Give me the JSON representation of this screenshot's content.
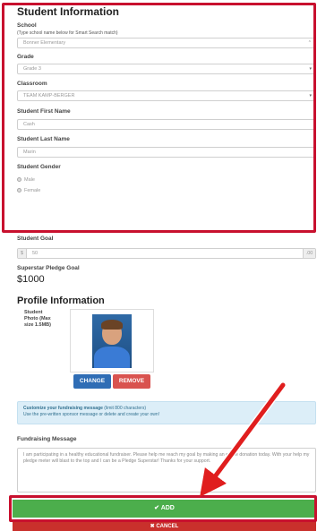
{
  "student_info": {
    "title": "Student Information",
    "school_label": "School",
    "school_hint": "(Type school name below for Smart Search match)",
    "school_value": "Bonner Elementary",
    "grade_label": "Grade",
    "grade_value": "Grade 3",
    "classroom_label": "Classroom",
    "classroom_value": "TEAM KAMP-BERGER",
    "first_name_label": "Student First Name",
    "first_name_value": "Cash",
    "last_name_label": "Student Last Name",
    "last_name_value": "Marin",
    "gender_label": "Student Gender",
    "gender_options": [
      "Male",
      "Female"
    ]
  },
  "goal": {
    "label": "Student Goal",
    "prefix": "$",
    "value": "50",
    "suffix": ".00"
  },
  "superstar": {
    "label": "Superstar Pledge Goal",
    "value": "$1000"
  },
  "profile": {
    "title": "Profile Information",
    "photo_label": "Student Photo (Max size 1.5MB)",
    "change_label": "CHANGE",
    "remove_label": "REMOVE"
  },
  "message_info": {
    "strong": "Customize your fundraising message",
    "limit": " (limit 800 characters)",
    "line2": "Use the pre-written sponsor message or delete and create your own!"
  },
  "fundraising": {
    "label": "Fundraising Message",
    "text": "I am participating in a healthy educational fundraiser. Please help me reach my goal by making an online donation today. With your help my pledge meter will blast to the top and I can be a Pledge Superstar! Thanks for your support."
  },
  "actions": {
    "add_label": "✔ ADD",
    "cancel_label": "✖ CANCEL"
  },
  "colors": {
    "highlight": "#c8102e",
    "add_green": "#4cae4c",
    "change_blue": "#2f6db5",
    "remove_red": "#d9534f"
  }
}
